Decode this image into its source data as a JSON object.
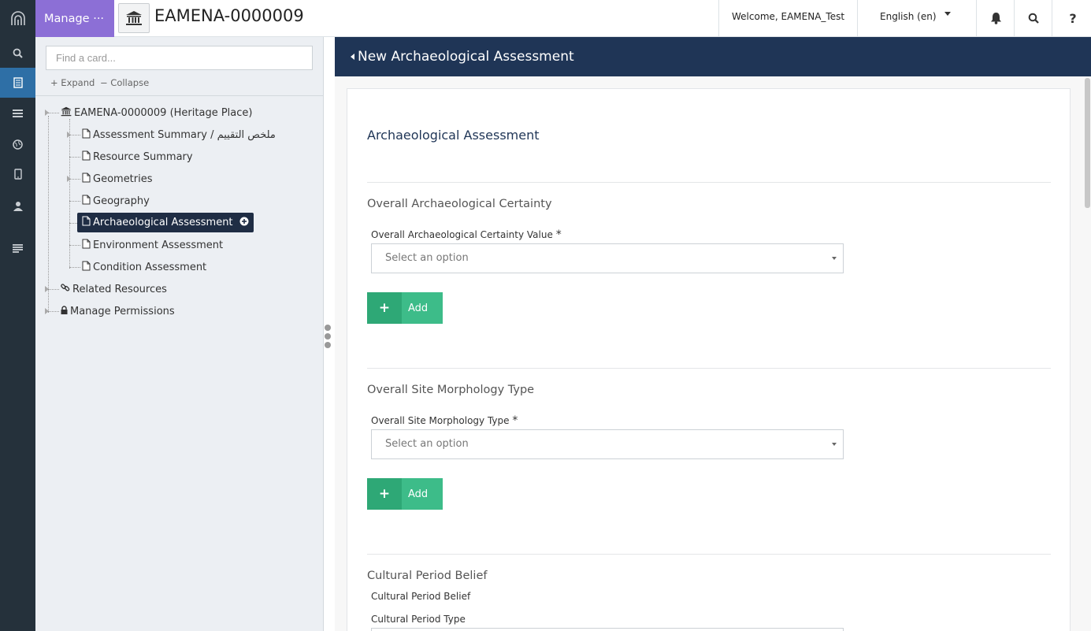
{
  "topbar": {
    "manage_label": "Manage ···",
    "resource_title": "EAMENA-0000009",
    "welcome": "Welcome, EAMENA_Test",
    "language": "English (en)",
    "help": "?"
  },
  "sidebar": {
    "find_placeholder": "Find a card...",
    "expand": "Expand",
    "collapse": "Collapse",
    "root": "EAMENA-0000009 (Heritage Place)",
    "items": [
      {
        "label": "Assessment Summary / ملخص التقييم"
      },
      {
        "label": "Resource Summary"
      },
      {
        "label": "Geometries"
      },
      {
        "label": "Geography"
      },
      {
        "label": "Archaeological Assessment"
      },
      {
        "label": "Environment Assessment"
      },
      {
        "label": "Condition Assessment"
      }
    ],
    "related_resources": "Related Resources",
    "manage_permissions": "Manage Permissions"
  },
  "main": {
    "header": "New Archaeological Assessment",
    "card_title": "Archaeological Assessment",
    "sections": [
      {
        "title": "Overall Archaeological Certainty",
        "field_label": "Overall Archaeological Certainty Value",
        "required": "*",
        "select_placeholder": "Select an option",
        "add_label": "Add"
      },
      {
        "title": "Overall Site Morphology Type",
        "field_label": "Overall Site Morphology Type",
        "required": "*",
        "select_placeholder": "Select an option",
        "add_label": "Add"
      },
      {
        "title": "Cultural Period Belief",
        "sub_label": "Cultural Period Belief",
        "field_label": "Cultural Period Type"
      }
    ]
  },
  "colors": {
    "rail": "#25313b",
    "manage": "#8c6fd6",
    "header": "#1f3556",
    "add_button": "#3dbc89",
    "selected_node": "#1f2d44"
  }
}
